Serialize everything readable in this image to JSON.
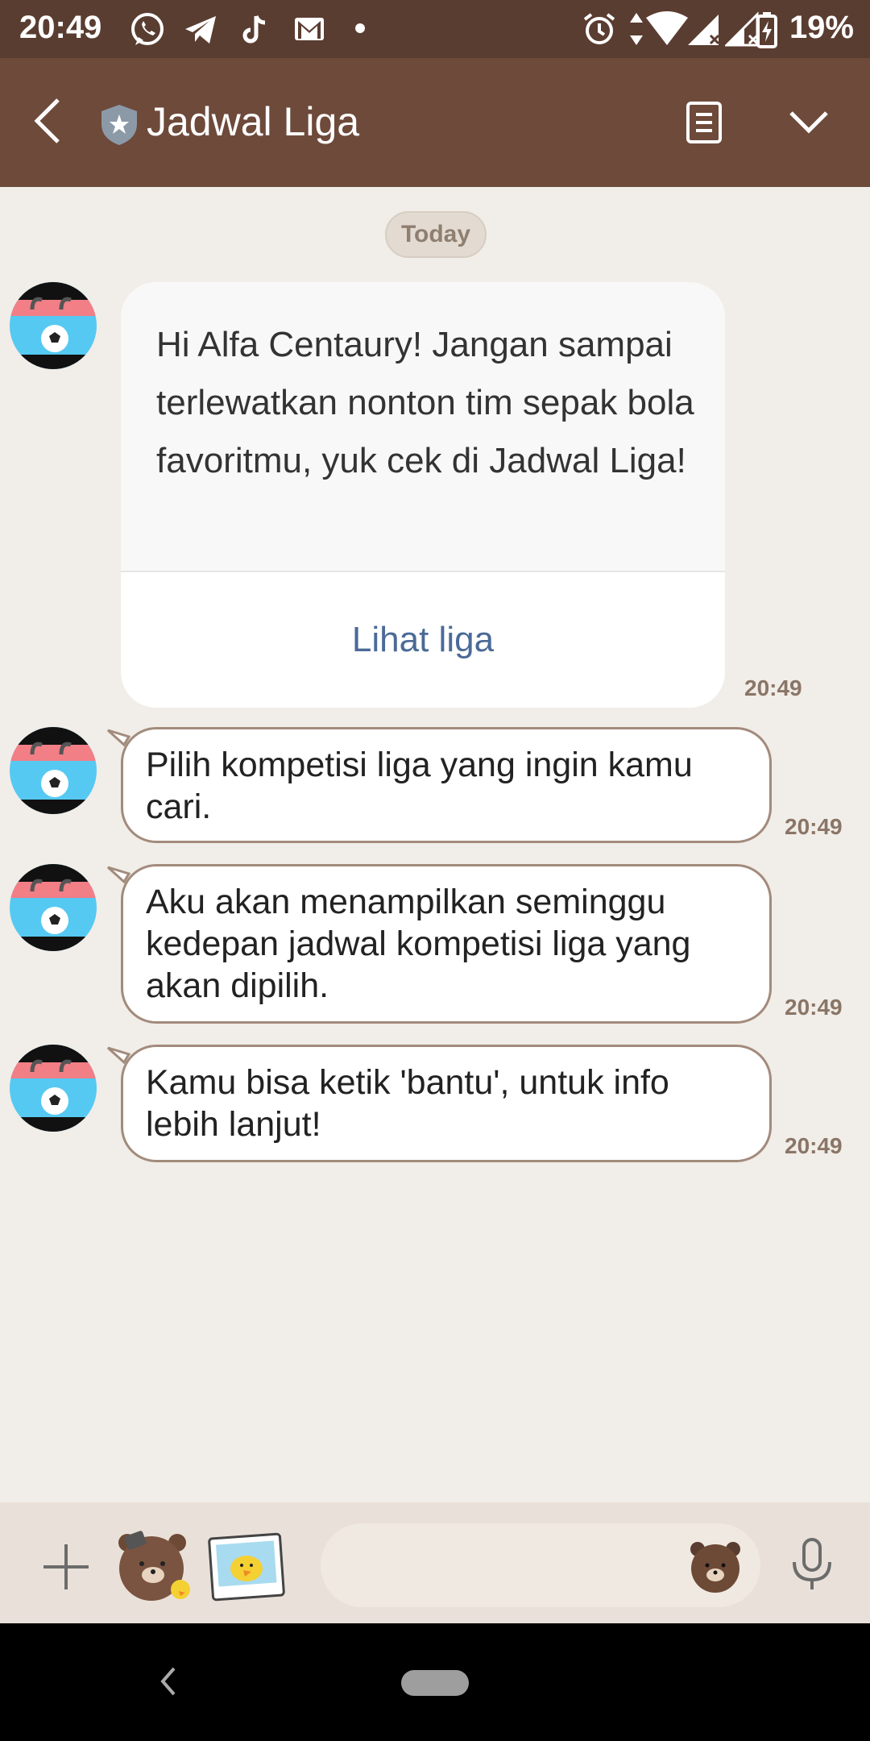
{
  "status_bar": {
    "time": "20:49",
    "battery": "19%",
    "icons": [
      "whatsapp-icon",
      "telegram-icon",
      "tiktok-icon",
      "gmail-icon",
      "dot-icon",
      "alarm-icon",
      "data-arrows-icon",
      "wifi-icon",
      "signal-icon",
      "signal-icon",
      "battery-charging-icon"
    ]
  },
  "header": {
    "title": "Jadwal Liga",
    "back_icon": "back-arrow-icon",
    "badge_icon": "shield-star-icon",
    "notes_icon": "note-icon",
    "menu_icon": "chevron-down-icon"
  },
  "chat": {
    "date_label": "Today",
    "card": {
      "text": "Hi Alfa Centaury! Jangan sampai terlewatkan nonton tim sepak bola favoritmu, yuk cek di Jadwal Liga!",
      "link_label": "Lihat liga",
      "time": "20:49"
    },
    "messages": [
      {
        "text": "Pilih kompetisi liga yang ingin kamu cari.",
        "time": "20:49"
      },
      {
        "text": "Aku akan menampilkan seminggu kedepan jadwal kompetisi liga yang akan dipilih.",
        "time": "20:49"
      },
      {
        "text": "Kamu bisa ketik 'bantu', untuk info lebih lanjut!",
        "time": "20:49"
      }
    ]
  },
  "input_bar": {
    "placeholder": "",
    "icons": [
      "plus-icon",
      "brown-sticker-icon",
      "sally-photo-icon",
      "emoji-bear-icon",
      "microphone-icon"
    ]
  },
  "colors": {
    "status_bar": "#5a3d31",
    "header": "#6e4a3b",
    "chat_bg": "#f1ede8",
    "link": "#4b6a97",
    "bubble_border": "#a28b7c"
  }
}
